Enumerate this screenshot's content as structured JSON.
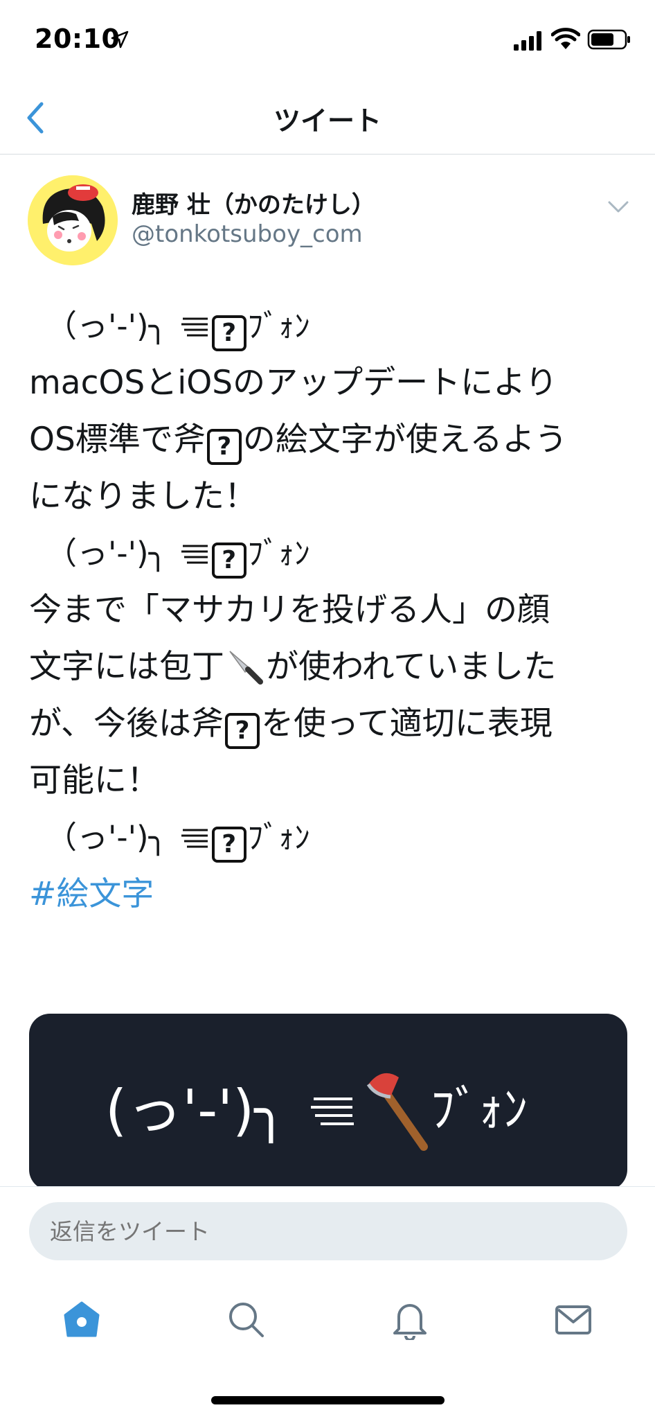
{
  "status_bar": {
    "time": "20:10",
    "icons": [
      "location-arrow-icon",
      "signal-icon",
      "wifi-icon",
      "battery-icon"
    ]
  },
  "nav": {
    "back_icon": "chevron-left-icon",
    "title": "ツイート"
  },
  "author": {
    "name": "鹿野 壮（かのたけし）",
    "handle": "@tonkotsuboy_com",
    "menu_icon": "chevron-down-icon"
  },
  "tweet": {
    "kaomoji_a": "（っ'-')╮",
    "kaomoji_b": "ﾌﾞｫﾝ",
    "missing_glyph": "?",
    "p1_l1": "macOSとiOSのアップデートにより",
    "p1_l2a": "OS標準で斧",
    "p1_l2b": "の絵文字が使えるよう",
    "p1_l3": "になりました！",
    "p2_l1": "今まで「マサカリを投げる人」の顔",
    "p2_l2a": "文字には包丁",
    "p2_l2b": "が使われていました",
    "p2_l3a": "が、今後は斧",
    "p2_l3b": "を使って適切に表現",
    "p2_l4": "可能に！",
    "hashtag": "#絵文字"
  },
  "media": {
    "kaomoji": "(っ'-')╮",
    "kana": "ﾌﾞｫﾝ",
    "icon": "axe-icon"
  },
  "reply": {
    "placeholder": "返信をツイート"
  },
  "tabs": [
    "home-icon",
    "search-icon",
    "bell-icon",
    "mail-icon"
  ],
  "colors": {
    "accent": "#3b94d9",
    "media_bg": "#1a202c",
    "reply_bg": "#e6ecf0",
    "avatar_bg": "#fff06c"
  }
}
